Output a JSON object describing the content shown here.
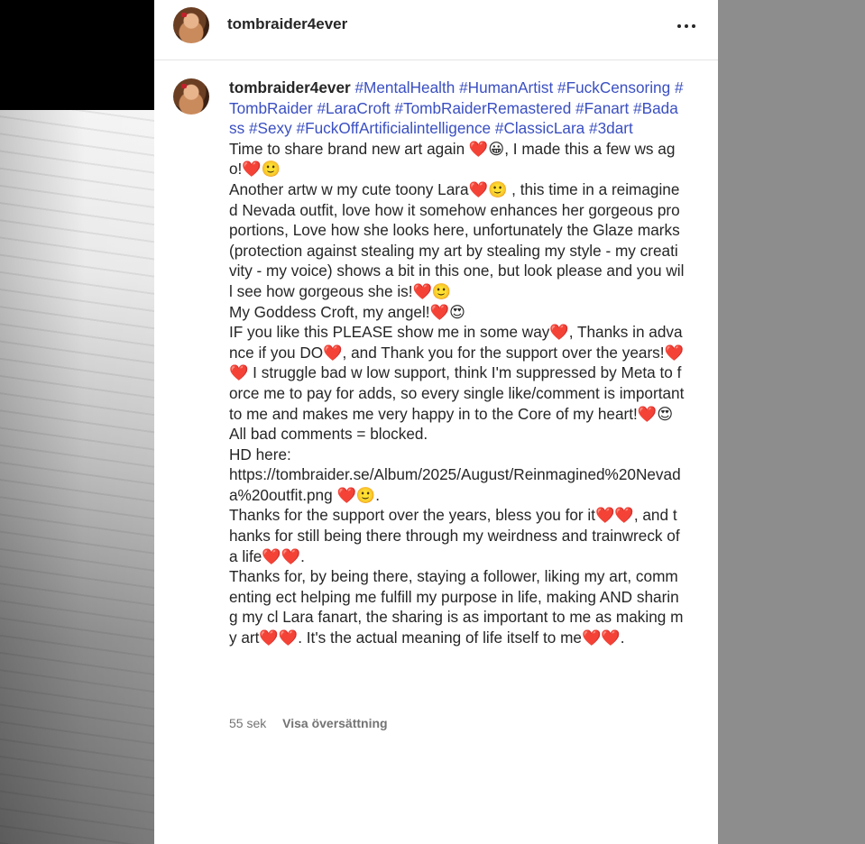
{
  "post": {
    "username": "tombraider4ever",
    "more_icon": "more-horizontal-icon"
  },
  "comment": {
    "username": "tombraider4ever",
    "hashtags": [
      "#MentalHealth",
      "#HumanArtist",
      "#FuckCensoring",
      "#TombRaider",
      "#LaraCroft",
      "#TombRaiderRemastered",
      "#Fanart",
      "#Badass",
      "#Sexy",
      "#FuckOffArtificialintelligence",
      "#ClassicLara",
      "#3dart"
    ],
    "body": "Time to share brand new art again ❤️😀, I made this a few ws ago!❤️🙂\nAnother artw w my cute toony Lara❤️🙂 , this time in a reimagined Nevada outfit, love how it somehow enhances her gorgeous proportions, Love how she looks here, unfortunately the Glaze marks (protection against stealing my art by stealing my style - my creativity - my voice) shows a bit in this one, but look please and you will see how gorgeous she is!❤️🙂\nMy Goddess Croft, my angel!❤️😍\nIF you like this PLEASE show me in some way❤️, Thanks in advance if you DO❤️, and Thank you for the support over the years!❤️❤️ I struggle bad w low support, think I'm suppressed by Meta to force me to pay for adds, so every single like/comment is important to me and makes me very happy in to the Core of my heart!❤️😍\nAll bad comments = blocked.\nHD here:\nhttps://tombraider.se/Album/2025/August/Reinmagined%20Nevada%20outfit.png ❤️🙂.\nThanks for the support over the years, bless you for it❤️❤️, and thanks for still being there through my weirdness and trainwreck of a life❤️❤️.\nThanks for, by being there, staying a follower, liking my art, commenting ect helping me fulfill my purpose in life, making AND sharing my cl Lara fanart, the sharing is as important to me as making my art❤️❤️. It's the actual meaning of life itself to me❤️❤️.",
    "time": "55 sek",
    "translate_label": "Visa översättning"
  }
}
